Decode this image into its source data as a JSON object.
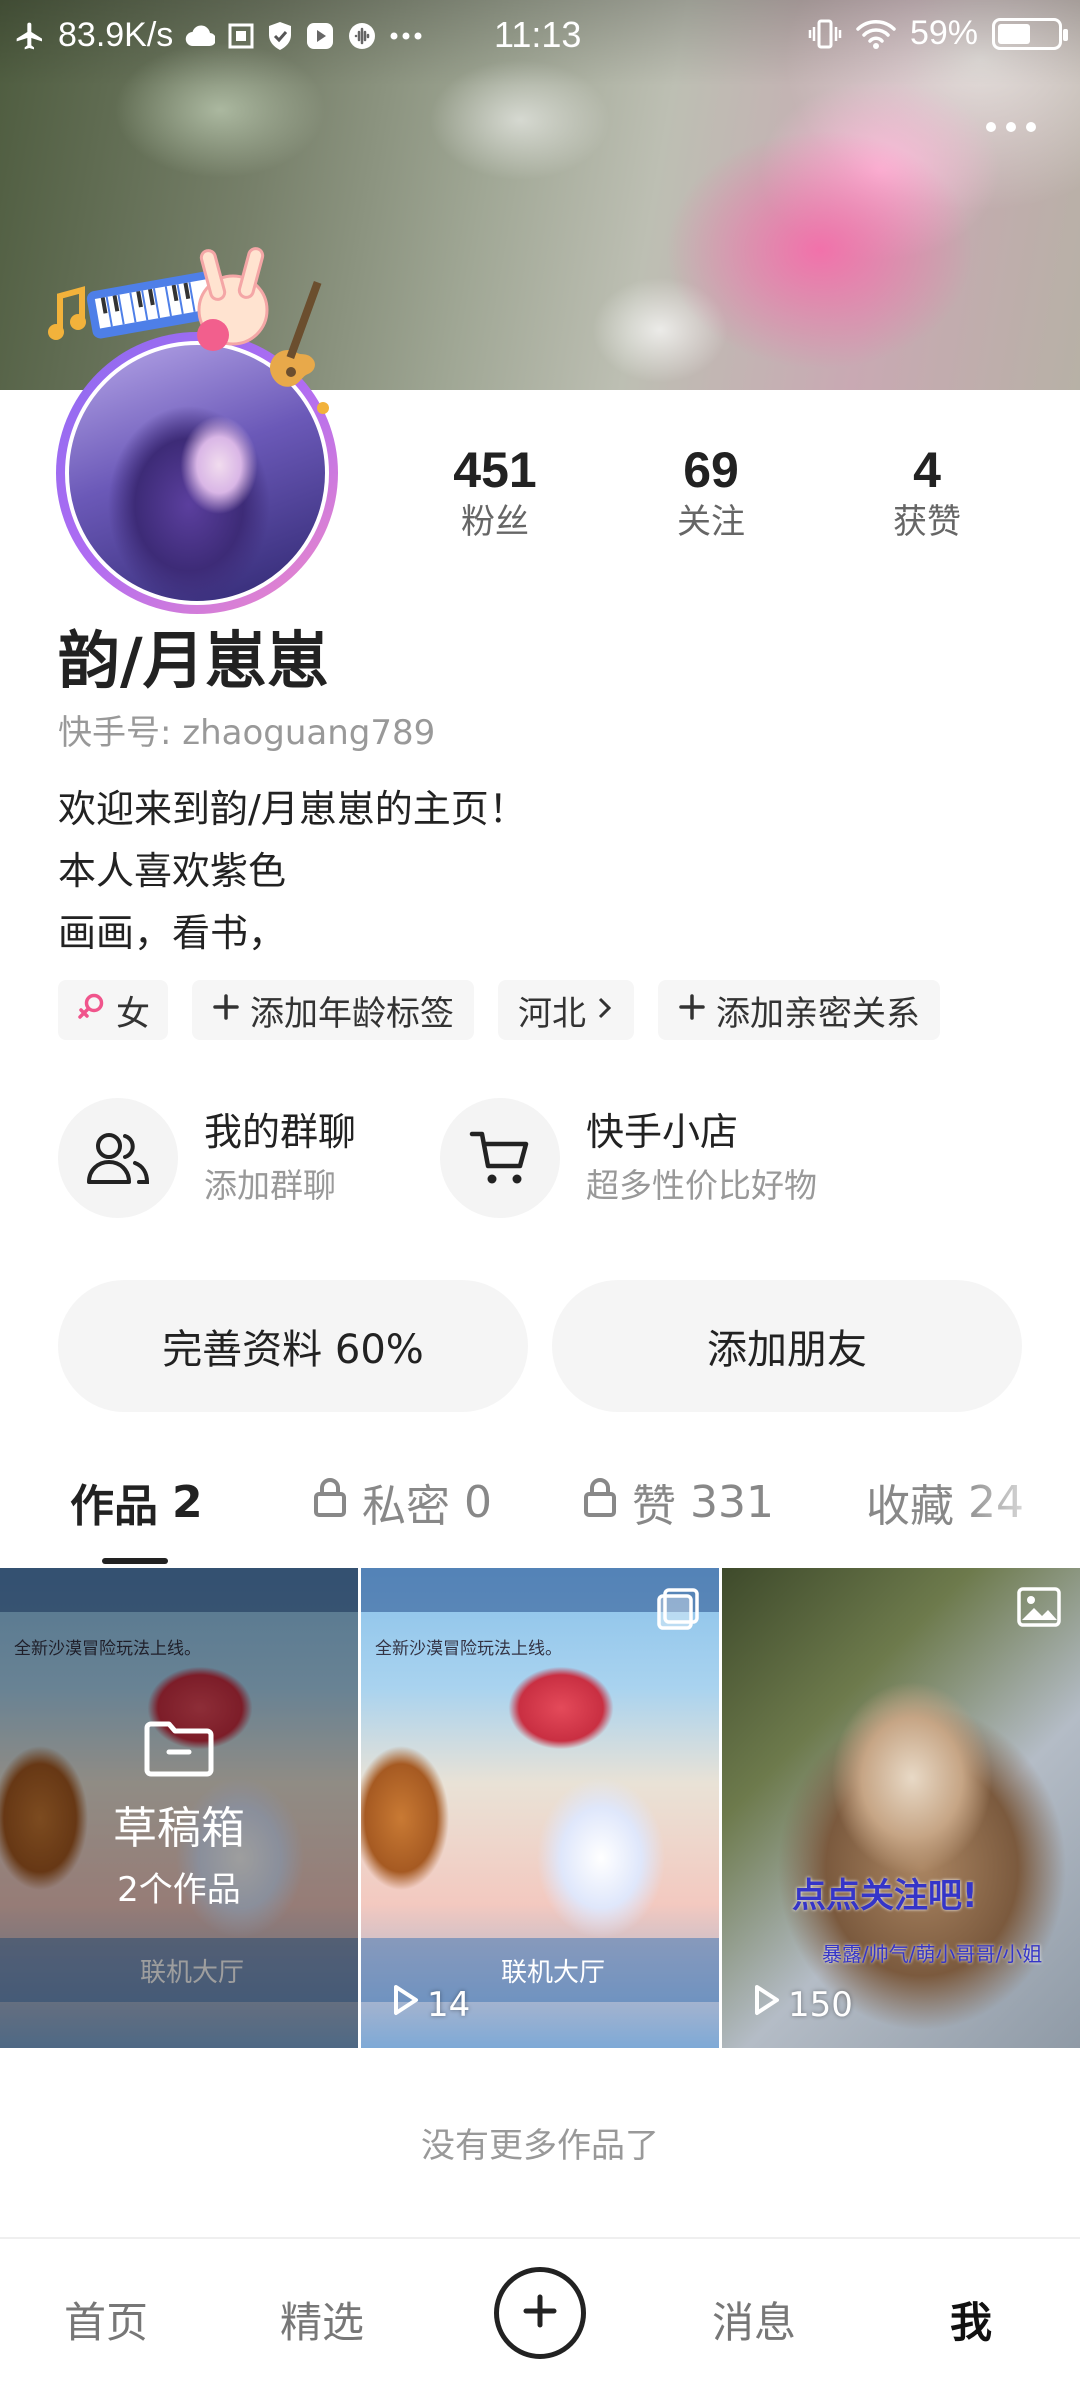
{
  "status_bar": {
    "speed": "83.9K/s",
    "time": "11:13",
    "battery_percent": "59%",
    "battery_level": 0.59
  },
  "profile": {
    "name": "韵/月崽崽",
    "kuaishou_id": "快手号: zhaoguang789",
    "bio": [
      "欢迎来到韵/月崽崽的主页！",
      "本人喜欢紫色",
      "画画，看书，"
    ],
    "stats": [
      {
        "value": "451",
        "label": "粉丝"
      },
      {
        "value": "69",
        "label": "关注"
      },
      {
        "value": "4",
        "label": "获赞"
      }
    ],
    "tags": {
      "gender": "女",
      "age": "添加年龄标签",
      "location": "河北",
      "relation": "添加亲密关系"
    }
  },
  "shortcuts": {
    "group": {
      "title": "我的群聊",
      "subtitle": "添加群聊"
    },
    "shop": {
      "title": "快手小店",
      "subtitle": "超多性价比好物"
    }
  },
  "buttons": {
    "complete_profile": "完善资料 60%",
    "add_friend": "添加朋友"
  },
  "tabs": {
    "works": {
      "label": "作品",
      "count": "2"
    },
    "private": {
      "label": "私密",
      "count": "0"
    },
    "likes": {
      "label": "赞",
      "count": "331"
    },
    "favorites": {
      "label": "收藏",
      "count": "24"
    }
  },
  "grid": {
    "draft": {
      "title": "草稿箱",
      "count": "2个作品"
    },
    "game_text": {
      "banner": "全新沙漠冒险玩法上线。",
      "hall": "联机大厅"
    },
    "video2": {
      "plays": "14"
    },
    "video3": {
      "plays": "150",
      "caption": "点点关注吧!",
      "sub": "暴露/帅气/萌小哥哥/小姐"
    }
  },
  "footer_note": "没有更多作品了",
  "bottom_nav": {
    "home": "首页",
    "featured": "精选",
    "messages": "消息",
    "me": "我"
  },
  "colors": {
    "avatar_ring_start": "#8a6bf0",
    "avatar_ring_end": "#f08ac5",
    "gender_icon": "#f0558c",
    "cat_caption": "#3535c8"
  }
}
